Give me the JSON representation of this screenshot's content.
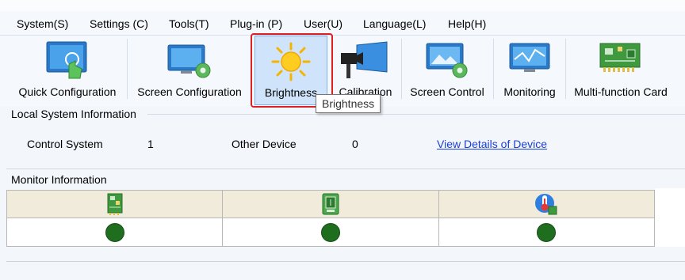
{
  "menu": [
    "System(S)",
    "Settings (C)",
    "Tools(T)",
    "Plug-in (P)",
    "User(U)",
    "Language(L)",
    "Help(H)"
  ],
  "toolbar": [
    {
      "label": "Quick Configuration",
      "icon": "quick-configuration-icon"
    },
    {
      "label": "Screen Configuration",
      "icon": "screen-configuration-icon"
    },
    {
      "label": "Brightness",
      "icon": "sun-icon",
      "selected": true
    },
    {
      "label": "Calibration",
      "icon": "calibration-camera-icon"
    },
    {
      "label": "Screen Control",
      "icon": "screen-control-icon"
    },
    {
      "label": "Monitoring",
      "icon": "monitoring-icon"
    },
    {
      "label": "Multi-function Card",
      "icon": "circuit-board-icon"
    }
  ],
  "tooltip": "Brightness",
  "local_system": {
    "title": "Local System Information",
    "control_system_label": "Control System",
    "control_system_value": "1",
    "other_device_label": "Other Device",
    "other_device_value": "0",
    "details_link": "View Details of Device"
  },
  "monitor": {
    "title": "Monitor Information",
    "columns": [
      "card-icon",
      "chip-icon",
      "thermometer-icon"
    ],
    "status_color": "#1f6d1f"
  },
  "colors": {
    "highlight": "#e02020",
    "link": "#1a3fd6"
  }
}
